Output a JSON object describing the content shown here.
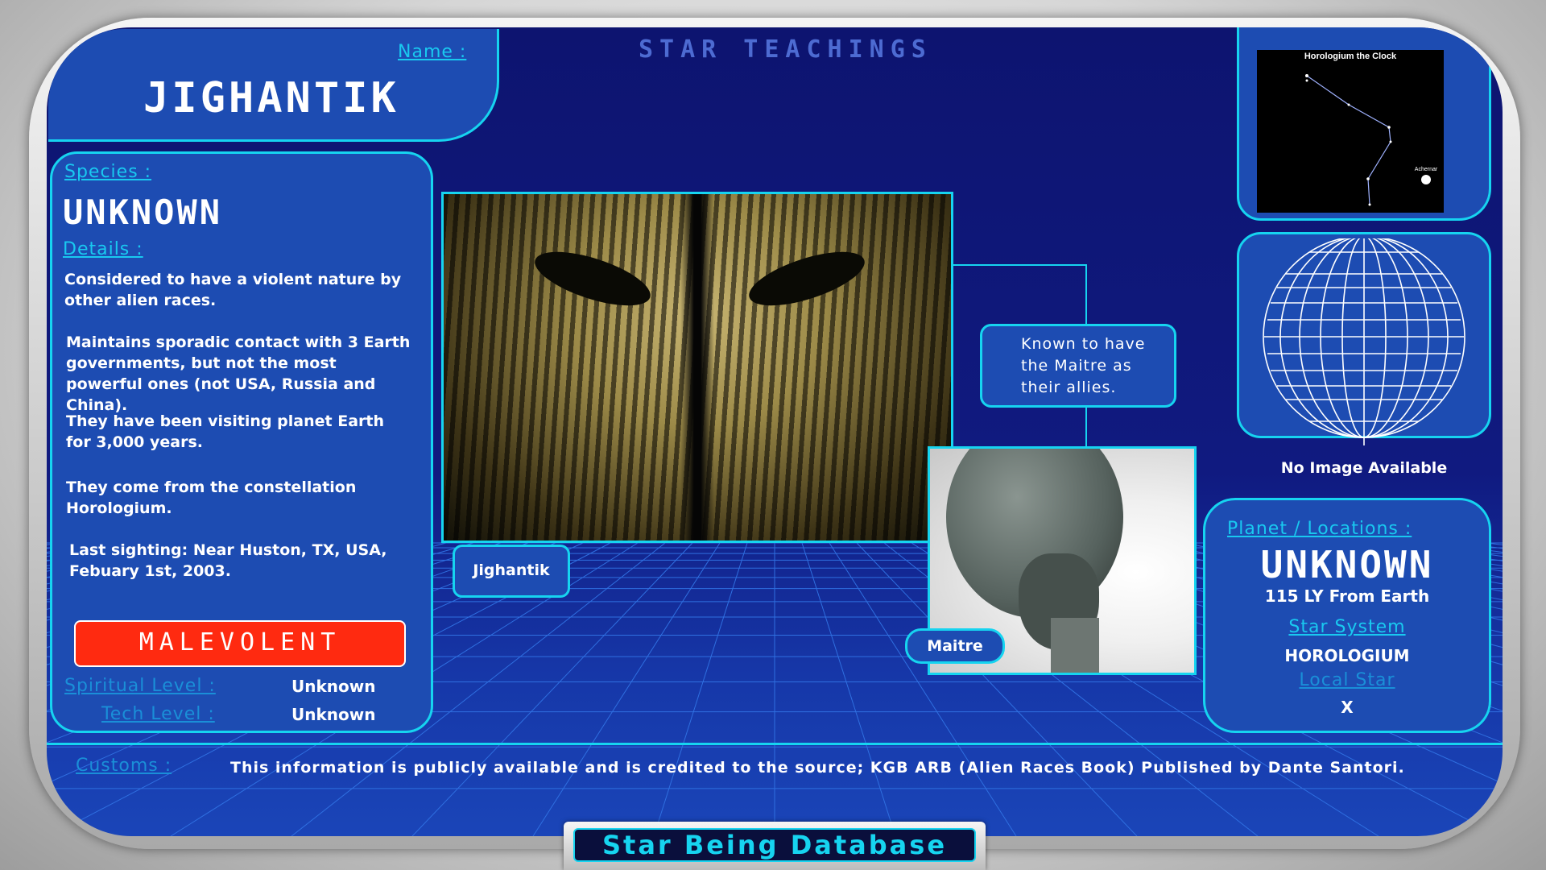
{
  "header": {
    "title": "STAR TEACHINGS",
    "name_label": "Name :",
    "name_value": "JIGHANTIK"
  },
  "species_panel": {
    "species_label": "Species :",
    "species_value": "UNKNOWN",
    "details_label": "Details :",
    "details": [
      "Considered to have a violent nature by other alien races.",
      "Maintains sporadic contact with 3 Earth governments, but not the most powerful ones (not USA, Russia and China).",
      "They have been visiting planet Earth for 3,000 years.",
      "They come from the constellation Horologium.",
      "Last sighting: Near Huston, TX, USA, Febuary 1st, 2003."
    ],
    "disposition": "MALEVOLENT",
    "spiritual_label": "Spiritual Level :",
    "spiritual_value": "Unknown",
    "tech_label": "Tech Level :",
    "tech_value": "Unknown"
  },
  "images": {
    "main_caption": "Jighantik",
    "ally_caption": "Maitre",
    "ally_note": "Known to have the Maitre as their allies."
  },
  "constellation": {
    "title": "Horologium the Clock",
    "star_label": "Achernar"
  },
  "globe": {
    "caption": "No Image Available"
  },
  "location_panel": {
    "planet_label": "Planet / Locations :",
    "planet_value": "UNKNOWN",
    "distance": "115 LY From Earth",
    "star_system_label": "Star System",
    "star_system_value": "HOROLOGIUM",
    "local_star_label": "Local Star",
    "local_star_value": "X"
  },
  "footer": {
    "customs_label": "Customs :",
    "credit": "This information is publicly available and is credited to the source; KGB ARB (Alien Races Book) Published by Dante Santori.",
    "database_title": "Star Being Database"
  },
  "colors": {
    "accent": "#16d4f0",
    "panel": "#1d4cb2",
    "background": "#0d1470",
    "disposition": "#ff2a10"
  }
}
